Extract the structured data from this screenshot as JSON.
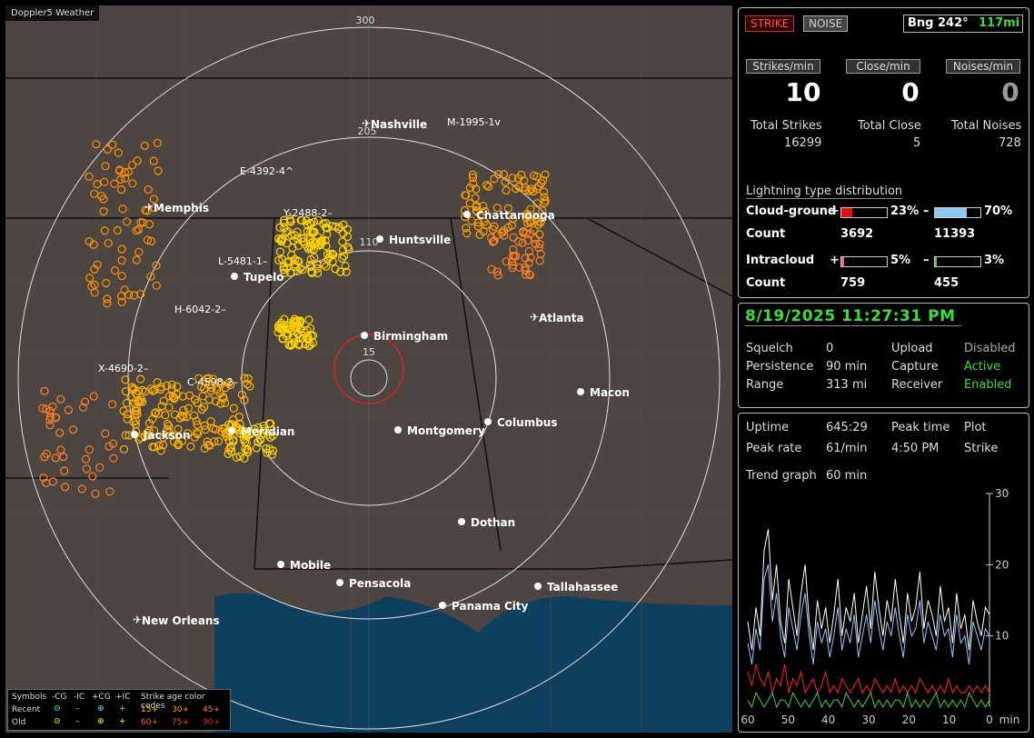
{
  "app_title": "Doppler5 Weather",
  "map": {
    "range_labels": [
      "300",
      "205",
      "110",
      "15"
    ],
    "cities": [
      "Nashville",
      "Memphis",
      "Chattanooga",
      "Huntsville",
      "Tupelo",
      "Atlanta",
      "Birmingham",
      "Macon",
      "Jackson",
      "Meridian",
      "Montgomery",
      "Columbus",
      "Dothan",
      "Mobile",
      "Pensacola",
      "Tallahassee",
      "Panama City",
      "New Orleans"
    ],
    "cell_labels": [
      "M-1995-1v",
      "E-4392-4^",
      "Y-2488-2–",
      "L-5481-1–",
      "H-6042-2–",
      "X-4690-2–",
      "C-4598-2–"
    ]
  },
  "legend": {
    "symbols_label": "Symbols",
    "col_headers": [
      "-CG",
      "-IC",
      "+CG",
      "+IC"
    ],
    "age_header": "Strike age color codes",
    "recent_label": "Recent",
    "old_label": "Old",
    "recent_ages": [
      "15+",
      "30+",
      "45+"
    ],
    "old_ages": [
      "60+",
      "75+",
      "90+"
    ],
    "glyphs": [
      "⊝",
      "–",
      "⊕",
      "+"
    ]
  },
  "top_panel": {
    "strike_button": "STRIKE",
    "noise_button": "NOISE",
    "bearing": "Bng 242°",
    "distance": "117mi",
    "rate_labels": [
      "Strikes/min",
      "Close/min",
      "Noises/min"
    ],
    "rate_values": [
      "10",
      "0",
      "0"
    ],
    "total_labels": [
      "Total Strikes",
      "Total Close",
      "Total Noises"
    ],
    "total_values": [
      "16299",
      "5",
      "728"
    ],
    "dist_title": "Lightning type distribution",
    "cloud_ground_label": "Cloud-ground",
    "intracloud_label": "Intracloud",
    "count_label": "Count",
    "plus_sign": "+",
    "minus_sign": "–",
    "cg_pos_pct": "23%",
    "cg_neg_pct": "70%",
    "cg_pos_count": "3692",
    "cg_neg_count": "11393",
    "ic_pos_pct": "5%",
    "ic_neg_pct": "3%",
    "ic_pos_count": "759",
    "ic_neg_count": "455",
    "cg_pos_fill": 0.23,
    "cg_neg_fill": 0.7,
    "ic_pos_fill": 0.05,
    "ic_neg_fill": 0.03
  },
  "status_panel": {
    "datetime": "8/19/2025 11:27:31 PM",
    "squelch_label": "Squelch",
    "squelch_value": "0",
    "persistence_label": "Persistence",
    "persistence_value": "90 min",
    "range_label": "Range",
    "range_value": "313 mi",
    "upload_label": "Upload",
    "upload_value": "Disabled",
    "capture_label": "Capture",
    "capture_value": "Active",
    "receiver_label": "Receiver",
    "receiver_value": "Enabled"
  },
  "stats_panel": {
    "uptime_label": "Uptime",
    "uptime_value": "645:29",
    "peak_time_label": "Peak time",
    "peak_time_value": "4:50 PM",
    "plot_label": "Plot",
    "plot_value": "Strike",
    "peak_rate_label": "Peak rate",
    "peak_rate_value": "61/min",
    "trend_label": "Trend graph",
    "trend_value": "60 min"
  },
  "chart_data": {
    "type": "line",
    "x_tick_labels": [
      "60",
      "50",
      "40",
      "30",
      "20",
      "10",
      "0",
      "min"
    ],
    "y_tick_labels": [
      "30",
      "20",
      "10"
    ],
    "ylim": [
      0,
      30
    ],
    "xlim": [
      60,
      0
    ],
    "series": [
      {
        "color": "#ffffff",
        "values": [
          12,
          8,
          14,
          10,
          22,
          25,
          15,
          20,
          12,
          9,
          18,
          14,
          10,
          16,
          20,
          12,
          8,
          15,
          11,
          14,
          9,
          13,
          18,
          10,
          14,
          12,
          16,
          9,
          13,
          17,
          11,
          19,
          14,
          10,
          15,
          12,
          18,
          13,
          9,
          16,
          12,
          14,
          19,
          11,
          15,
          13,
          10,
          17,
          12,
          14,
          9,
          16,
          11,
          13,
          8,
          15,
          12,
          10,
          14,
          13
        ]
      },
      {
        "color": "#8fc8ff",
        "values": [
          9,
          6,
          11,
          8,
          18,
          20,
          12,
          16,
          10,
          7,
          14,
          11,
          8,
          13,
          16,
          10,
          6,
          12,
          9,
          11,
          7,
          10,
          14,
          8,
          11,
          9,
          13,
          7,
          10,
          13,
          9,
          15,
          11,
          8,
          12,
          10,
          14,
          10,
          7,
          13,
          10,
          11,
          15,
          9,
          12,
          10,
          8,
          13,
          10,
          11,
          7,
          13,
          9,
          10,
          6,
          12,
          10,
          8,
          11,
          10
        ]
      },
      {
        "color": "#ff2020",
        "values": [
          5,
          3,
          6,
          4,
          3,
          5,
          2,
          4,
          3,
          6,
          2,
          4,
          3,
          5,
          2,
          3,
          4,
          2,
          3,
          5,
          2,
          3,
          2,
          4,
          3,
          2,
          3,
          4,
          2,
          3,
          2,
          4,
          3,
          2,
          3,
          2,
          4,
          2,
          3,
          2,
          3,
          2,
          4,
          3,
          2,
          3,
          2,
          3,
          2,
          4,
          2,
          3,
          2,
          2,
          3,
          2,
          3,
          2,
          3,
          2
        ]
      },
      {
        "color": "#40d040",
        "values": [
          1,
          0,
          2,
          1,
          0,
          1,
          2,
          0,
          1,
          1,
          0,
          2,
          1,
          0,
          1,
          0,
          1,
          2,
          0,
          1,
          0,
          1,
          1,
          0,
          2,
          1,
          0,
          1,
          0,
          1,
          2,
          0,
          1,
          0,
          1,
          0,
          1,
          1,
          0,
          2,
          0,
          1,
          0,
          1,
          0,
          1,
          2,
          0,
          1,
          0,
          1,
          0,
          1,
          0,
          2,
          1,
          0,
          1,
          0,
          1
        ]
      }
    ]
  }
}
